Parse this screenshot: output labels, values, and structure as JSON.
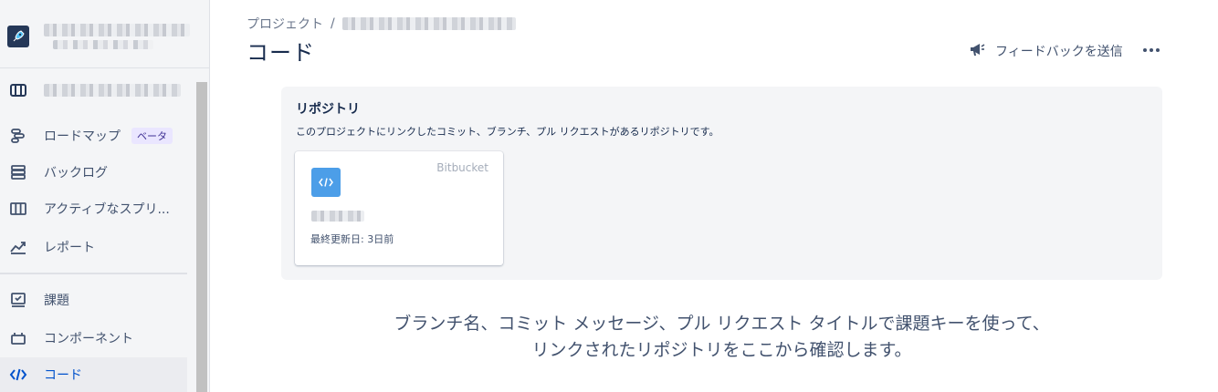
{
  "sidebar": {
    "items": [
      {
        "label": "ロードマップ",
        "badge": "ベータ",
        "icon": "roadmap-icon"
      },
      {
        "label": "バックログ",
        "icon": "backlog-icon"
      },
      {
        "label": "アクティブなスプリ...",
        "icon": "board-icon"
      },
      {
        "label": "レポート",
        "icon": "reports-icon"
      },
      {
        "label": "課題",
        "icon": "issues-icon"
      },
      {
        "label": "コンポーネント",
        "icon": "components-icon"
      },
      {
        "label": "コード",
        "icon": "code-icon",
        "active": true
      }
    ]
  },
  "breadcrumb": {
    "root": "プロジェクト",
    "separator": "/"
  },
  "page": {
    "title": "コード"
  },
  "header": {
    "feedback_label": "フィードバックを送信"
  },
  "repositories": {
    "title": "リポジトリ",
    "description": "このプロジェクトにリンクしたコミット、ブランチ、プル リクエストがあるリポジトリです。",
    "card": {
      "provider": "Bitbucket",
      "last_updated": "最終更新日: 3日前"
    }
  },
  "hint": {
    "line1": "ブランチ名、コミット メッセージ、プル リクエスト タイトルで課題キーを使って、",
    "line2": "リンクされたリポジトリをここから確認します。"
  },
  "colors": {
    "accent": "#0052cc",
    "repo_icon": "#4c9ee8",
    "badge_bg": "#eae6ff"
  }
}
